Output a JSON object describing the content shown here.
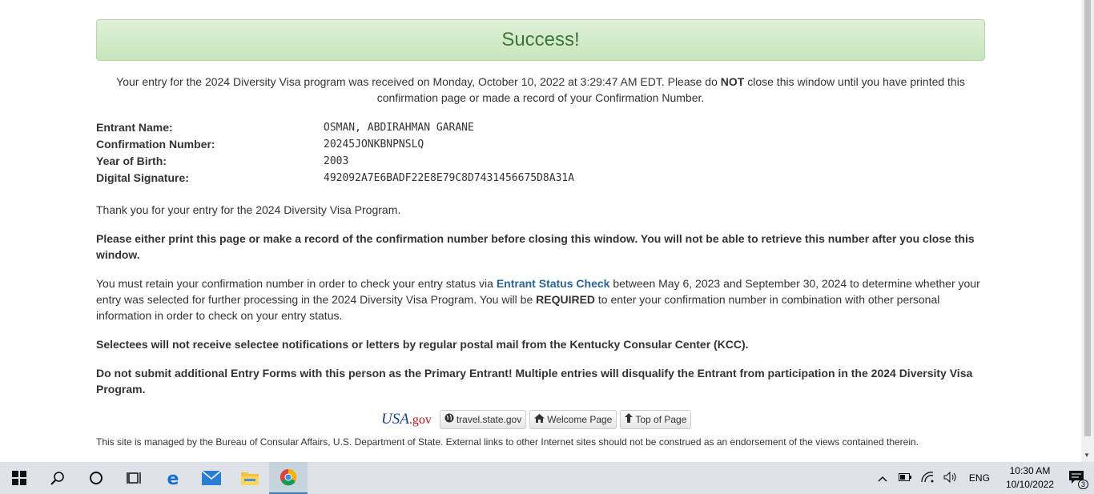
{
  "success_title": "Success!",
  "received": {
    "before": "Your entry for the 2024 Diversity Visa program was received on Monday, October 10, 2022 at 3:29:47 AM EDT. Please do ",
    "emph": "NOT",
    "after": " close this window until you have printed this confirmation page or made a record of your Confirmation Number."
  },
  "entrant": {
    "name_label": "Entrant Name:",
    "name_value": "OSMAN, ABDIRAHMAN GARANE",
    "conf_label": "Confirmation Number:",
    "conf_value": "20245JONKBNPNSLQ",
    "yob_label": "Year of Birth:",
    "yob_value": "2003",
    "sig_label": "Digital Signature:",
    "sig_value": "492092A7E6BADF22E8E79C8D7431456675D8A31A"
  },
  "thank_you": "Thank you for your entry for the 2024 Diversity Visa Program.",
  "print_warning": "Please either print this page or make a record of the confirmation number before closing this window. You will not be able to retrieve this number after you close this window.",
  "retain": {
    "before": "You must retain your confirmation number in order to check your entry status via ",
    "link": "Entrant Status Check",
    "middle": " between May 6, 2023 and September 30, 2024 to determine whether your entry was selected for further processing in the 2024 Diversity Visa Program. You will be ",
    "emph": "REQUIRED",
    "after": " to enter your confirmation number in combination with other personal information in order to check on your entry status."
  },
  "selectees": "Selectees will not receive selectee notifications or letters by regular postal mail from the Kentucky Consular Center (KCC).",
  "do_not_submit": "Do not submit additional Entry Forms with this person as the Primary Entrant! Multiple entries will disqualify the Entrant from participation in the 2024 Diversity Visa Program.",
  "footer": {
    "usagov_usa": "USA",
    "usagov_gov": ".gov",
    "travel_label": "travel.state.gov",
    "welcome_label": "Welcome Page",
    "top_label": "Top of Page",
    "managed": "This site is managed by the Bureau of Consular Affairs, U.S. Department of State. External links to other Internet sites should not be construed as an endorsement of the views contained therein."
  },
  "taskbar": {
    "lang": "ENG",
    "time": "10:30 AM",
    "date": "10/10/2022",
    "notif_count": "3"
  }
}
